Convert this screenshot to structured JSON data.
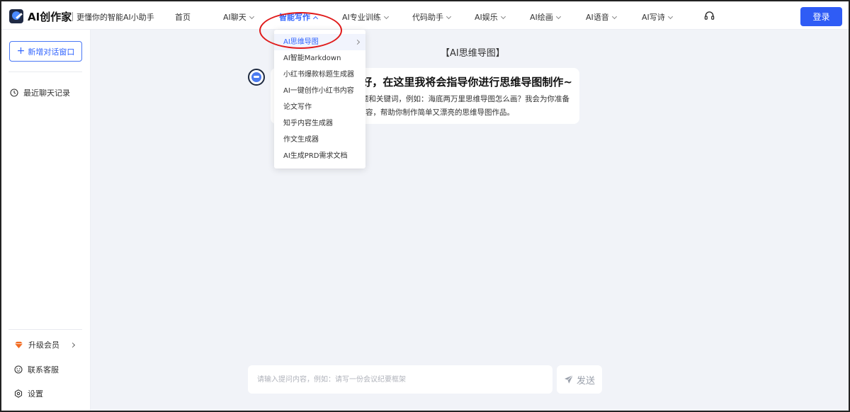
{
  "brand": {
    "name": "AI创作家",
    "slogan": "更懂你的智能AI小助手"
  },
  "nav": {
    "items": [
      {
        "label": "首页",
        "has_dropdown": false
      },
      {
        "label": "AI聊天",
        "has_dropdown": true
      },
      {
        "label": "智能写作",
        "has_dropdown": true,
        "active": true
      },
      {
        "label": "AI专业训练",
        "has_dropdown": true
      },
      {
        "label": "代码助手",
        "has_dropdown": true
      },
      {
        "label": "AI娱乐",
        "has_dropdown": true
      },
      {
        "label": "AI绘画",
        "has_dropdown": true
      },
      {
        "label": "AI语音",
        "has_dropdown": true
      },
      {
        "label": "AI写诗",
        "has_dropdown": true
      }
    ],
    "login_label": "登录"
  },
  "dropdown": {
    "items": [
      {
        "label": "AI思维导图",
        "selected": true,
        "has_submenu": true
      },
      {
        "label": "AI智能Markdown"
      },
      {
        "label": "小红书爆款标题生成器"
      },
      {
        "label": "AI一键创作小红书内容"
      },
      {
        "label": "论文写作"
      },
      {
        "label": "知乎内容生成器"
      },
      {
        "label": "作文生成器"
      },
      {
        "label": "AI生成PRD需求文档"
      }
    ]
  },
  "sidebar": {
    "new_chat_label": "新增对话窗口",
    "recent_label": "最近聊天记录",
    "upgrade_label": "升级会员",
    "contact_label": "联系客服",
    "settings_label": "设置"
  },
  "main": {
    "title": "【AI思维导图】",
    "bubble_title": "好，在这里我将会指导你进行思维导图制作~",
    "bubble_line1": "题和关键词，例如：海底两万里思维导图怎么画？我会为你准备",
    "bubble_line2": "内容，帮助你制作简单又漂亮的思维导图作品。"
  },
  "input": {
    "placeholder": "请输入提问内容，例如：请写一份会议纪要框架",
    "send_label": "发送"
  },
  "colors": {
    "accent": "#3366ff",
    "login_bg": "#2f5cf5",
    "highlight_ring": "#e01b1b",
    "upgrade_icon": "#f26b21"
  },
  "icons": {
    "logo": "logo-icon",
    "headset": "headset-icon",
    "clock": "clock-icon",
    "diamond": "diamond-icon",
    "service": "face-icon",
    "settings": "gear-icon",
    "send": "paper-plane-icon",
    "avatar": "bot-avatar-icon"
  }
}
